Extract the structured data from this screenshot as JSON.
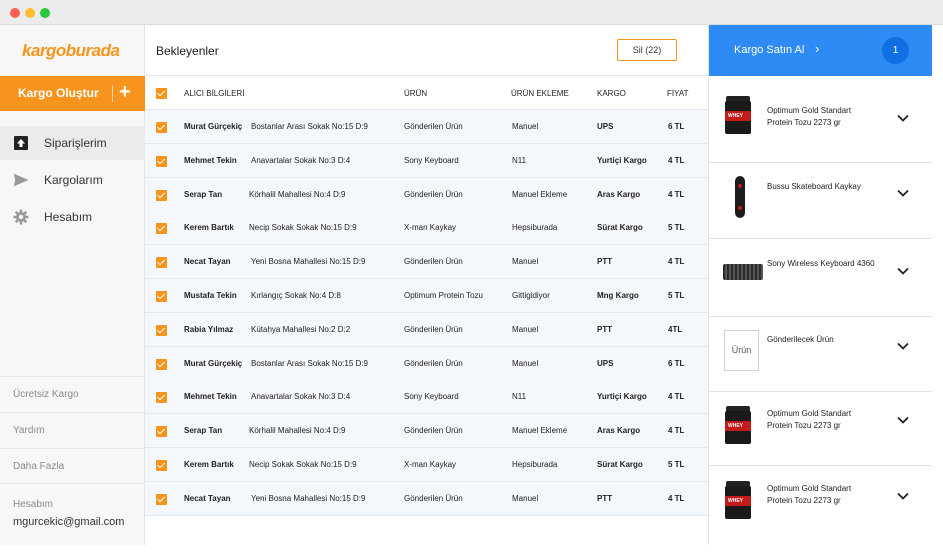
{
  "sidebar": {
    "logo": "kargoburada",
    "create_button": "Kargo Oluştur",
    "create_plus": "+",
    "nav": [
      {
        "label": "Siparişlerim",
        "icon": "upload-box-icon"
      },
      {
        "label": "Kargolarım",
        "icon": "paper-plane-icon"
      },
      {
        "label": "Hesabım",
        "icon": "gear-icon"
      }
    ],
    "links": [
      "Ücretsiz Kargo",
      "Yardım",
      "Daha Fazla"
    ],
    "account_label": "Hesabım",
    "account_email": "mgurcekic@gmail.com"
  },
  "main": {
    "title": "Bekleyenler",
    "delete_button": "Sil (22)",
    "columns": {
      "recipient": "ALICI BİLGİLERİ",
      "product": "ÜRÜN",
      "source": "ÜRÜN EKLEME",
      "carrier": "KARGO",
      "price": "FİYAT"
    },
    "rows": [
      {
        "name": "Murat Gürçekiç",
        "address": "Bostanlar Arası Sokak No:15 D:9",
        "product": "Gönderilen Ürün",
        "source": "Manuel",
        "carrier": "UPS",
        "price": "6 TL"
      },
      {
        "name": "Mehmet Tekin",
        "address": "Anavartalar Sokak No:3 D:4",
        "product": "Sony Keyboard",
        "source": "N11",
        "carrier": "Yurtiçi Kargo",
        "price": "4 TL"
      },
      {
        "name": "Serap Tan",
        "address": "Körhalil Mahallesi No:4 D:9",
        "product": "Gönderilen Ürün",
        "source": "Manuel Ekleme",
        "carrier": "Aras Kargo",
        "price": "4 TL"
      },
      {
        "name": "Kerem Bartık",
        "address": "Necip Sokak Sokak No:15 D:9",
        "product": "X-man Kaykay",
        "source": "Hepsiburada",
        "carrier": "Sürat Kargo",
        "price": "5 TL"
      },
      {
        "name": "Necat Tayan",
        "address": "Yeni Bosna Mahallesi No:15 D:9",
        "product": "Gönderilen Ürün",
        "source": "Manuel",
        "carrier": "PTT",
        "price": "4 TL"
      },
      {
        "name": "Mustafa Tekin",
        "address": "Kırlangıç Sokak No:4 D:8",
        "product": "Optimum Protein Tozu",
        "source": "Gittigidiyor",
        "carrier": "Mng Kargo",
        "price": "5 TL"
      },
      {
        "name": "Rabia Yılmaz",
        "address": "Kütahya Mahallesi No:2 D:2",
        "product": "Gönderilen Ürün",
        "source": "Manuel",
        "carrier": "PTT",
        "price": "4TL"
      },
      {
        "name": "Murat Gürçekiç",
        "address": "Bostanlar Arası Sokak No:15 D:9",
        "product": "Gönderilen Ürün",
        "source": "Manuel",
        "carrier": "UPS",
        "price": "6 TL"
      },
      {
        "name": "Mehmet Tekin",
        "address": "Anavartalar Sokak No:3 D:4",
        "product": "Sony Keyboard",
        "source": "N11",
        "carrier": "Yurtiçi Kargo",
        "price": "4 TL"
      },
      {
        "name": "Serap Tan",
        "address": "Körhalil Mahallesi No:4 D:9",
        "product": "Gönderilen Ürün",
        "source": "Manuel Ekleme",
        "carrier": "Aras Kargo",
        "price": "4 TL"
      },
      {
        "name": "Kerem Bartık",
        "address": "Necip Sokak Sokak No:15 D:9",
        "product": "X-man Kaykay",
        "source": "Hepsiburada",
        "carrier": "Sürat Kargo",
        "price": "5 TL"
      },
      {
        "name": "Necat Tayan",
        "address": "Yeni Bosna Mahallesi No:15 D:9",
        "product": "Gönderilen Ürün",
        "source": "Manuel",
        "carrier": "PTT",
        "price": "4 TL"
      }
    ]
  },
  "right": {
    "buy_label": "Kargo Satın Al",
    "buy_chevron": "›",
    "cart_count": "1",
    "products": [
      {
        "name": "Optimum Gold Standart Protein Tozu 2273 gr",
        "image": "protein-tub-icon"
      },
      {
        "name": "Bussu Skateboard Kaykay",
        "image": "skateboard-icon"
      },
      {
        "name": "Sony Wireless Keyboard 4360",
        "image": "keyboard-icon"
      },
      {
        "name": "Gönderilecek Ürün",
        "image": "placeholder-box",
        "placeholder_text": "Ürün"
      },
      {
        "name": "Optimum Gold Standart Protein Tozu 2273 gr",
        "image": "protein-tub-icon"
      },
      {
        "name": "Optimum Gold Standart Protein Tozu 2273 gr",
        "image": "protein-tub-icon"
      }
    ]
  },
  "colors": {
    "brand_orange": "#f7941d",
    "accent_blue": "#2e8bf5",
    "row_bg": "#f4f7fb"
  }
}
